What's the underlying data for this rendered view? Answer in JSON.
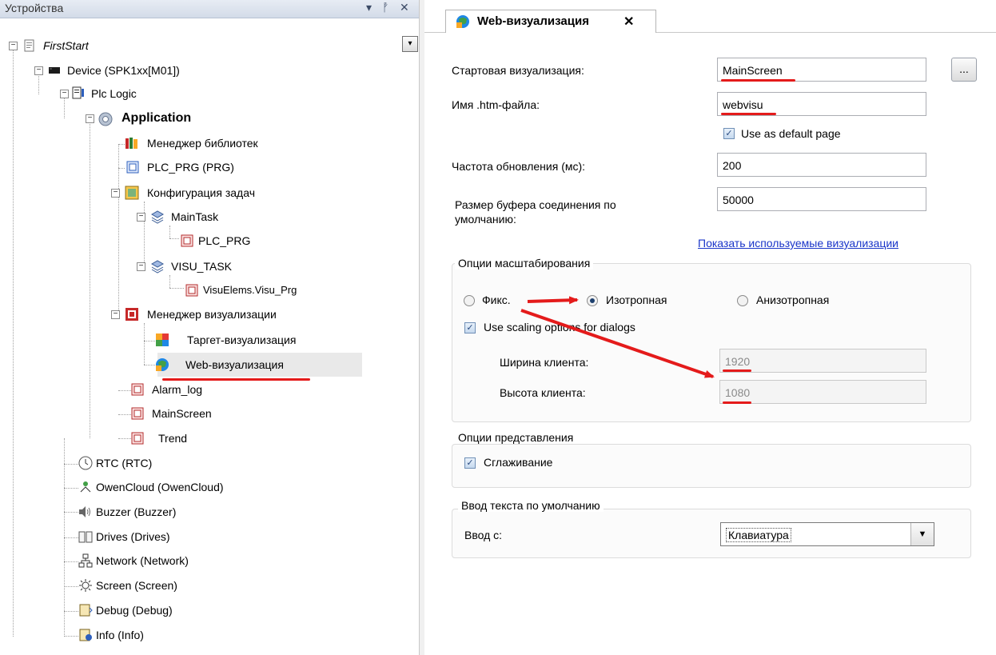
{
  "devices_pane": {
    "title": "Устройства",
    "pin_glyph": "ᚡ",
    "menu_glyph": "▾",
    "close_glyph": "✕",
    "dropdown_glyph": "▾",
    "tree": [
      {
        "label": "FirstStart",
        "italic": true
      },
      {
        "label": "Device (SPK1xx[M01])"
      },
      {
        "label": "Plc Logic"
      },
      {
        "label": "Application",
        "bold": true
      },
      {
        "label": "Менеджер библиотек"
      },
      {
        "label": "PLC_PRG (PRG)"
      },
      {
        "label": "Конфигурация задач"
      },
      {
        "label": "MainTask"
      },
      {
        "label": "PLC_PRG"
      },
      {
        "label": "VISU_TASK"
      },
      {
        "label": "VisuElems.Visu_Prg"
      },
      {
        "label": "Менеджер визуализации"
      },
      {
        "label": "Таргет-визуализация"
      },
      {
        "label": "Web-визуализация",
        "selected": true
      },
      {
        "label": "Alarm_log"
      },
      {
        "label": "MainScreen"
      },
      {
        "label": "Trend"
      },
      {
        "label": "RTC (RTC)"
      },
      {
        "label": "OwenCloud (OwenCloud)"
      },
      {
        "label": "Buzzer (Buzzer)"
      },
      {
        "label": "Drives (Drives)"
      },
      {
        "label": "Network (Network)"
      },
      {
        "label": "Screen (Screen)"
      },
      {
        "label": "Debug (Debug)"
      },
      {
        "label": "Info (Info)"
      }
    ]
  },
  "editor": {
    "tab_label": "Web-визуализация",
    "tab_close": "✕",
    "start_visu_label": "Стартовая визуализация:",
    "start_visu_value": "MainScreen",
    "browse_label": "...",
    "htm_label": "Имя .htm-файла:",
    "htm_value": "webvisu",
    "default_page_label": "Use as default page",
    "default_page_checked": true,
    "update_rate_label": "Частота обновления (мс):",
    "update_rate_value": "200",
    "buffer_label_line1": "Размер буфера соединения по",
    "buffer_label_line2": "умолчанию:",
    "buffer_value": "50000",
    "show_used_link": "Показать используемые визуализации",
    "scaling": {
      "title": "Опции масштабирования",
      "fixed": "Фикс.",
      "isotropic": "Изотропная",
      "anisotropic": "Анизотропная",
      "selected": "isotropic",
      "dialogs_label": "Use scaling options for dialogs",
      "dialogs_checked": true,
      "width_label": "Ширина клиента:",
      "width_value": "1920",
      "height_label": "Высота клиента:",
      "height_value": "1080"
    },
    "presentation": {
      "title": "Опции представления",
      "antialias_label": "Сглаживание",
      "antialias_checked": true
    },
    "text_input": {
      "title": "Ввод текста по умолчанию",
      "input_label": "Ввод с:",
      "input_value": "Клавиатура"
    }
  },
  "annotations_color": "#e41b1b",
  "check_glyph": "✓"
}
